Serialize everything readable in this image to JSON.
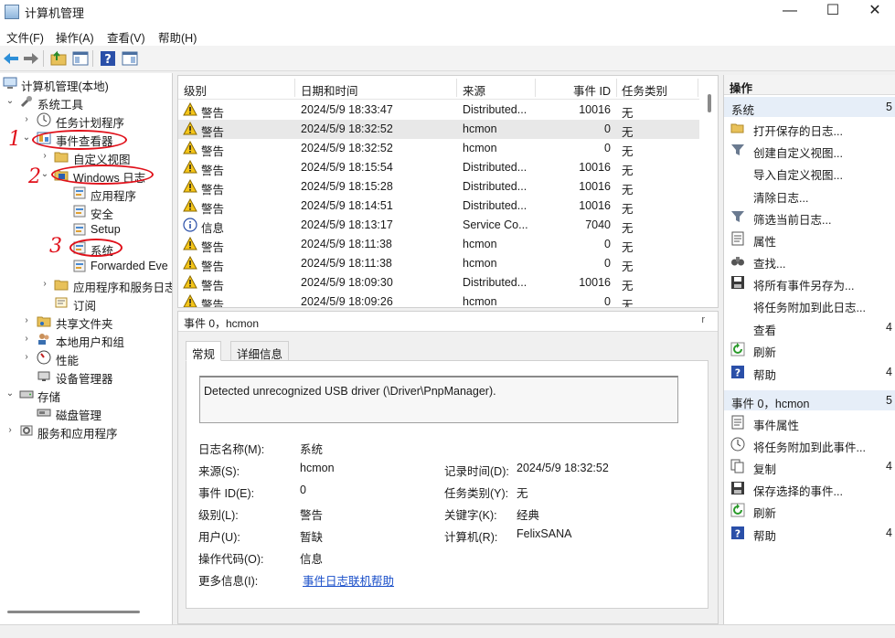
{
  "window": {
    "title": "计算机管理",
    "minimize_glyph": "—",
    "maximize_glyph": "☐",
    "close_glyph": "✕"
  },
  "menu": [
    "文件(F)",
    "操作(A)",
    "查看(V)",
    "帮助(H)"
  ],
  "toolbar": {
    "icons": [
      "back-arrow-icon",
      "forward-arrow-icon",
      "up-folder-icon",
      "show-tree-icon",
      "help-icon",
      "properties-icon"
    ]
  },
  "tree": [
    {
      "label": "计算机管理(本地)",
      "icon": "computer-icon"
    },
    {
      "label": "系统工具",
      "icon": "tools-icon"
    },
    {
      "label": "任务计划程序",
      "icon": "clock-icon"
    },
    {
      "label": "事件查看器",
      "icon": "event-viewer-icon"
    },
    {
      "label": "自定义视图",
      "icon": "folder-icon"
    },
    {
      "label": "Windows 日志",
      "icon": "log-folder-icon"
    },
    {
      "label": "应用程序",
      "icon": "log-icon"
    },
    {
      "label": "安全",
      "icon": "log-icon"
    },
    {
      "label": "Setup",
      "icon": "log-icon"
    },
    {
      "label": "系统",
      "icon": "log-icon"
    },
    {
      "label": "Forwarded Eve",
      "icon": "log-icon"
    },
    {
      "label": "应用程序和服务日志",
      "icon": "folder-icon"
    },
    {
      "label": "订阅",
      "icon": "subscription-icon"
    },
    {
      "label": "共享文件夹",
      "icon": "shared-folder-icon"
    },
    {
      "label": "本地用户和组",
      "icon": "users-icon"
    },
    {
      "label": "性能",
      "icon": "performance-icon"
    },
    {
      "label": "设备管理器",
      "icon": "device-icon"
    },
    {
      "label": "存储",
      "icon": "storage-icon"
    },
    {
      "label": "磁盘管理",
      "icon": "disk-icon"
    },
    {
      "label": "服务和应用程序",
      "icon": "services-icon"
    }
  ],
  "annotations": [
    "1",
    "2",
    "3"
  ],
  "events": {
    "columns": [
      "级别",
      "日期和时间",
      "来源",
      "事件 ID",
      "任务类别"
    ],
    "rows": [
      {
        "level": "警告",
        "icon": "warning-icon",
        "time": "2024/5/9 18:33:47",
        "source": "Distributed...",
        "id": "10016",
        "task": "无"
      },
      {
        "level": "警告",
        "icon": "warning-icon",
        "time": "2024/5/9 18:32:52",
        "source": "hcmon",
        "id": "0",
        "task": "无"
      },
      {
        "level": "警告",
        "icon": "warning-icon",
        "time": "2024/5/9 18:32:52",
        "source": "hcmon",
        "id": "0",
        "task": "无"
      },
      {
        "level": "警告",
        "icon": "warning-icon",
        "time": "2024/5/9 18:15:54",
        "source": "Distributed...",
        "id": "10016",
        "task": "无"
      },
      {
        "level": "警告",
        "icon": "warning-icon",
        "time": "2024/5/9 18:15:28",
        "source": "Distributed...",
        "id": "10016",
        "task": "无"
      },
      {
        "level": "警告",
        "icon": "warning-icon",
        "time": "2024/5/9 18:14:51",
        "source": "Distributed...",
        "id": "10016",
        "task": "无"
      },
      {
        "level": "信息",
        "icon": "info-icon",
        "time": "2024/5/9 18:13:17",
        "source": "Service Co...",
        "id": "7040",
        "task": "无"
      },
      {
        "level": "警告",
        "icon": "warning-icon",
        "time": "2024/5/9 18:11:38",
        "source": "hcmon",
        "id": "0",
        "task": "无"
      },
      {
        "level": "警告",
        "icon": "warning-icon",
        "time": "2024/5/9 18:11:38",
        "source": "hcmon",
        "id": "0",
        "task": "无"
      },
      {
        "level": "警告",
        "icon": "warning-icon",
        "time": "2024/5/9 18:09:30",
        "source": "Distributed...",
        "id": "10016",
        "task": "无"
      },
      {
        "level": "警告",
        "icon": "warning-icon",
        "time": "2024/5/9 18:09:26",
        "source": "hcmon",
        "id": "0",
        "task": "无"
      }
    ]
  },
  "detail": {
    "title": "事件 0，hcmon",
    "close": "r",
    "tabs": [
      "常规",
      "详细信息"
    ],
    "message": "Detected unrecognized USB driver (\\Driver\\PnpManager).",
    "props": {
      "log_name_label": "日志名称(M):",
      "log_name": "系统",
      "source_label": "来源(S):",
      "source": "hcmon",
      "logged_label": "记录时间(D):",
      "logged": "2024/5/9 18:32:52",
      "event_id_label": "事件 ID(E):",
      "event_id": "0",
      "task_label": "任务类别(Y):",
      "task": "无",
      "level_label": "级别(L):",
      "level": "警告",
      "keywords_label": "关键字(K):",
      "keywords": "经典",
      "user_label": "用户(U):",
      "user": "暂缺",
      "computer_label": "计算机(R):",
      "computer": "FelixSANA",
      "opcode_label": "操作代码(O):",
      "opcode": "信息",
      "more_label": "更多信息(I):",
      "more_link": "事件日志联机帮助"
    }
  },
  "actions": {
    "title": "操作",
    "section1": {
      "label": "系统",
      "count": "5"
    },
    "items1": [
      {
        "label": "打开保存的日志...",
        "icon": "open-folder-icon",
        "count": ""
      },
      {
        "label": "创建自定义视图...",
        "icon": "filter-icon",
        "count": ""
      },
      {
        "label": "导入自定义视图...",
        "icon": "",
        "count": ""
      },
      {
        "label": "清除日志...",
        "icon": "",
        "count": ""
      },
      {
        "label": "筛选当前日志...",
        "icon": "filter-icon",
        "count": ""
      },
      {
        "label": "属性",
        "icon": "properties-icon",
        "count": ""
      },
      {
        "label": "查找...",
        "icon": "binoculars-icon",
        "count": ""
      },
      {
        "label": "将所有事件另存为...",
        "icon": "save-icon",
        "count": ""
      },
      {
        "label": "将任务附加到此日志...",
        "icon": "",
        "count": ""
      },
      {
        "label": "查看",
        "icon": "",
        "count": "4"
      },
      {
        "label": "刷新",
        "icon": "refresh-icon",
        "count": ""
      },
      {
        "label": "帮助",
        "icon": "help-icon",
        "count": "4"
      }
    ],
    "section2": {
      "label": "事件 0，hcmon",
      "count": "5"
    },
    "items2": [
      {
        "label": "事件属性",
        "icon": "properties-icon",
        "count": ""
      },
      {
        "label": "将任务附加到此事件...",
        "icon": "task-icon",
        "count": ""
      },
      {
        "label": "复制",
        "icon": "copy-icon",
        "count": "4"
      },
      {
        "label": "保存选择的事件...",
        "icon": "save-icon",
        "count": ""
      },
      {
        "label": "刷新",
        "icon": "refresh-icon",
        "count": ""
      },
      {
        "label": "帮助",
        "icon": "help-icon",
        "count": "4"
      }
    ]
  }
}
